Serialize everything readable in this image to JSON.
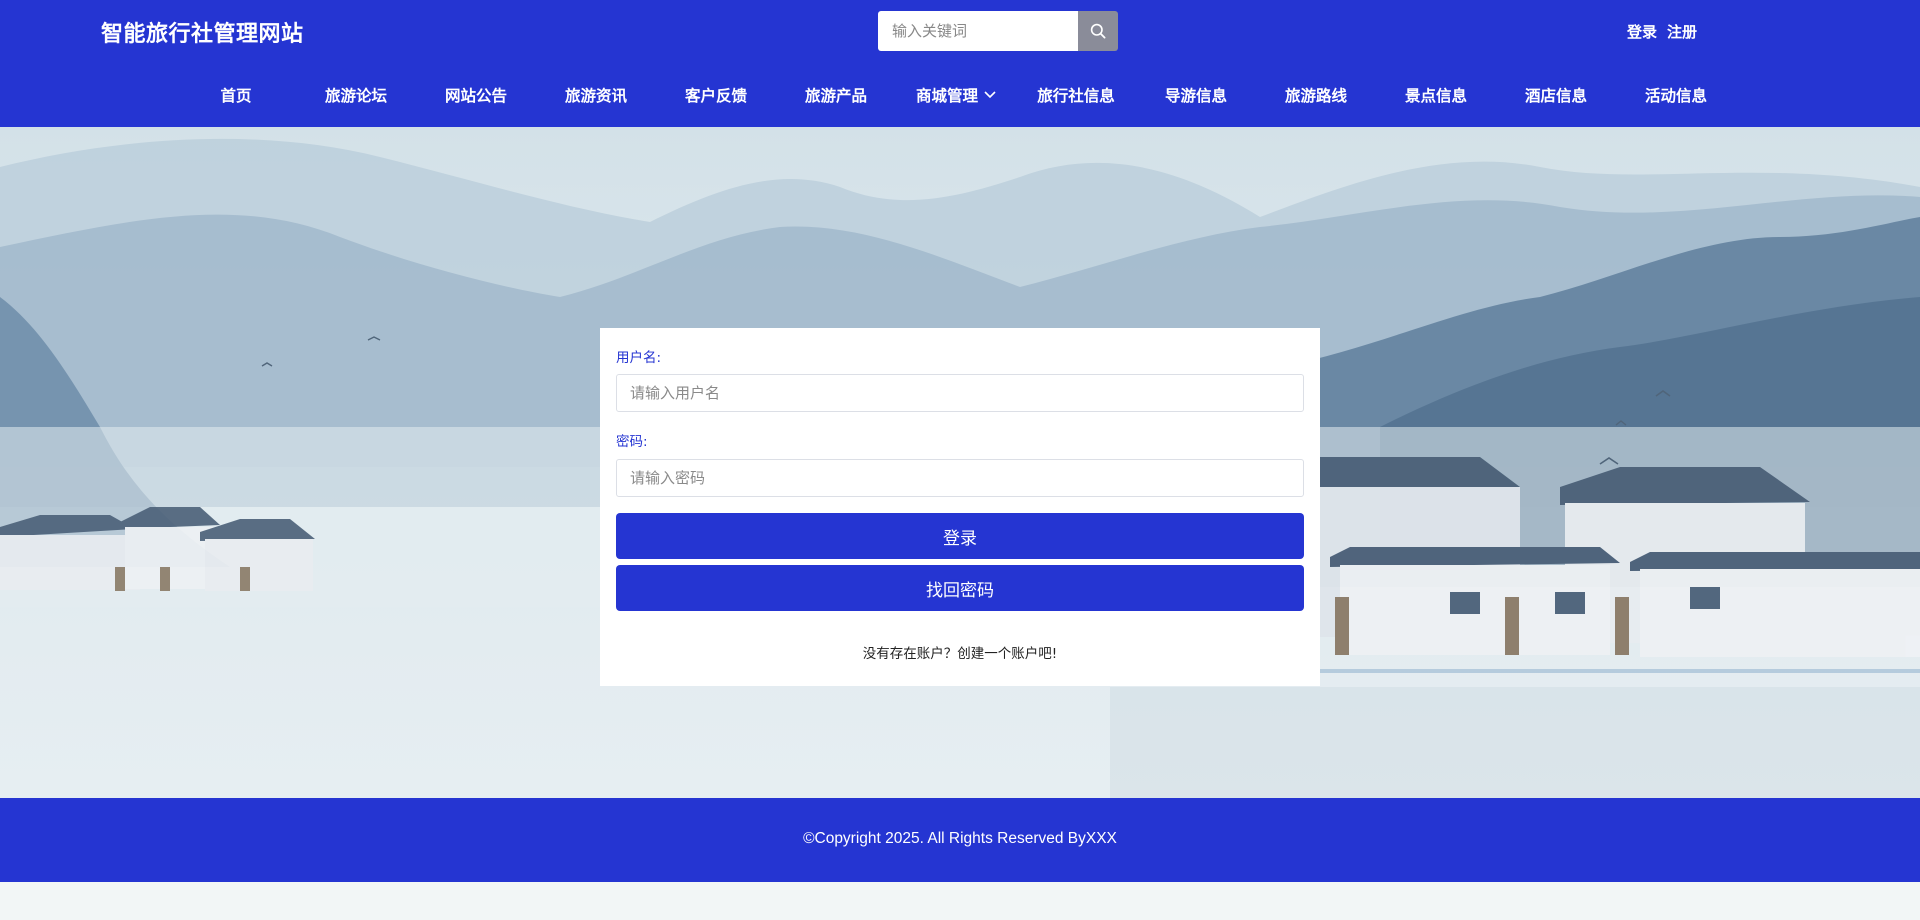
{
  "header": {
    "site_title": "智能旅行社管理网站",
    "search": {
      "placeholder": "输入关键词",
      "value": ""
    },
    "auth": {
      "login": "登录",
      "register": "注册"
    }
  },
  "nav": {
    "items": [
      {
        "label": "首页"
      },
      {
        "label": "旅游论坛"
      },
      {
        "label": "网站公告"
      },
      {
        "label": "旅游资讯"
      },
      {
        "label": "客户反馈"
      },
      {
        "label": "旅游产品"
      },
      {
        "label": "商城管理",
        "has_dropdown": true
      },
      {
        "label": "旅行社信息"
      },
      {
        "label": "导游信息"
      },
      {
        "label": "旅游路线"
      },
      {
        "label": "景点信息"
      },
      {
        "label": "酒店信息"
      },
      {
        "label": "活动信息"
      }
    ]
  },
  "login_form": {
    "username_label": "用户名:",
    "username_placeholder": "请输入用户名",
    "password_label": "密码:",
    "password_placeholder": "请输入密码",
    "login_button": "登录",
    "forgot_button": "找回密码",
    "register_hint": "没有存在账户？创建一个账户吧!"
  },
  "footer": {
    "copyright": "©Copyright 2025. All Rights Reserved ByXXX"
  },
  "colors": {
    "brand": "#2535d2",
    "search_button": "#8a8c99",
    "page_background": "#f2f6f6"
  },
  "icons": {
    "search": "search-icon",
    "dropdown": "chevron-down-icon"
  }
}
